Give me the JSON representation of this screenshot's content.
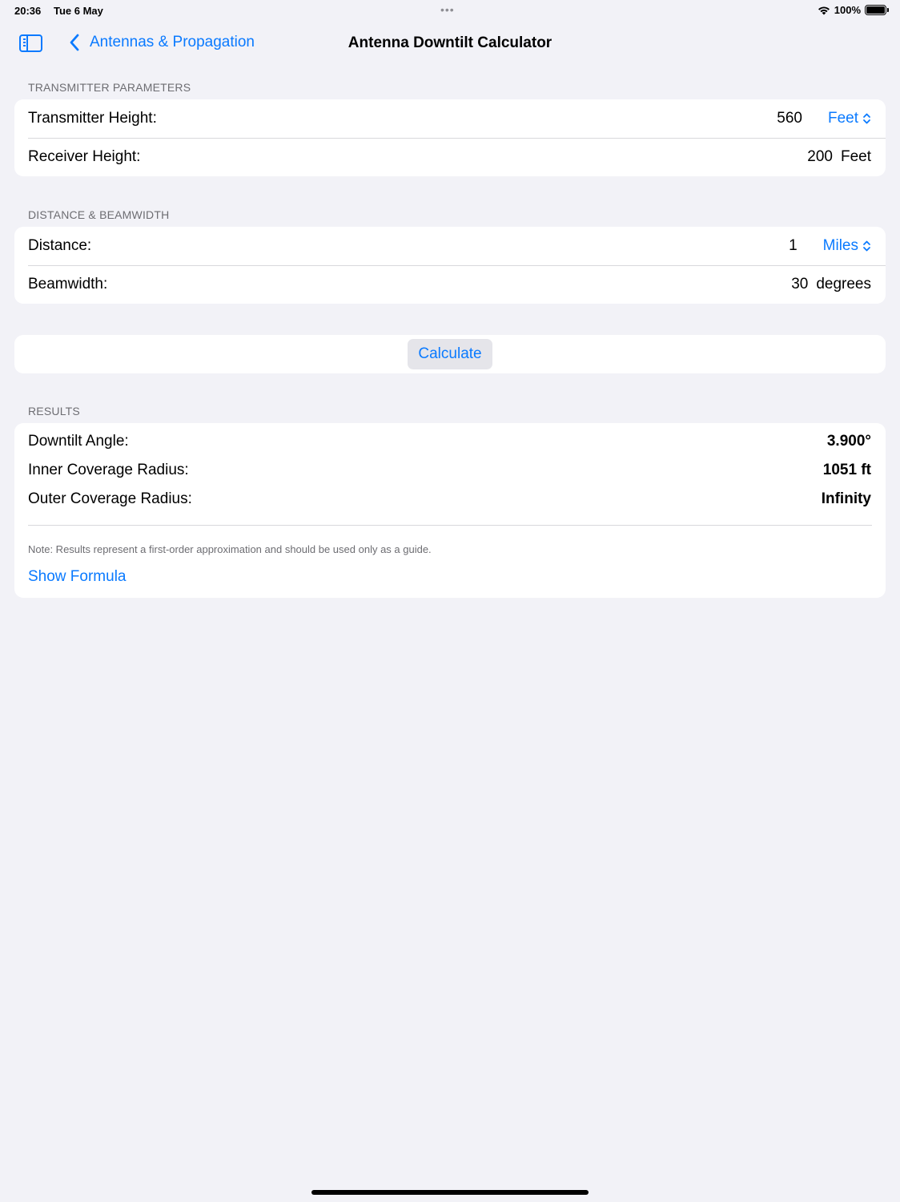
{
  "status_bar": {
    "time": "20:36",
    "date": "Tue 6 May",
    "battery_percent": "100%",
    "battery_level": 1.0,
    "multitasking_dots": "•••"
  },
  "nav": {
    "back_label": "Antennas & Propagation",
    "title": "Antenna Downtilt Calculator",
    "icons": {
      "sidebar": "sidebar-toggle-icon",
      "back": "chevron-left-icon"
    }
  },
  "transmitter": {
    "header": "TRANSMITTER PARAMETERS",
    "tx_height": {
      "label": "Transmitter Height:",
      "value": "560",
      "unit": "Feet"
    },
    "rx_height": {
      "label": "Receiver Height:",
      "value": "200",
      "unit": "Feet"
    }
  },
  "distance": {
    "header": "DISTANCE & BEAMWIDTH",
    "distance": {
      "label": "Distance:",
      "value": "1",
      "unit": "Miles"
    },
    "beamwidth": {
      "label": "Beamwidth:",
      "value": "30",
      "unit": "degrees"
    }
  },
  "calculate": {
    "label": "Calculate"
  },
  "results": {
    "header": "RESULTS",
    "downtilt": {
      "label": "Downtilt Angle:",
      "value": "3.900°"
    },
    "inner": {
      "label": "Inner Coverage Radius:",
      "value": "1051 ft"
    },
    "outer": {
      "label": "Outer Coverage Radius:",
      "value": "Infinity"
    },
    "note": "Note: Results represent a first-order approximation and should be used only as a guide.",
    "show_formula": "Show Formula"
  },
  "colors": {
    "accent": "#0a7aff",
    "background": "#f2f2f7",
    "card": "#ffffff",
    "secondary_text": "#6d6d72"
  }
}
